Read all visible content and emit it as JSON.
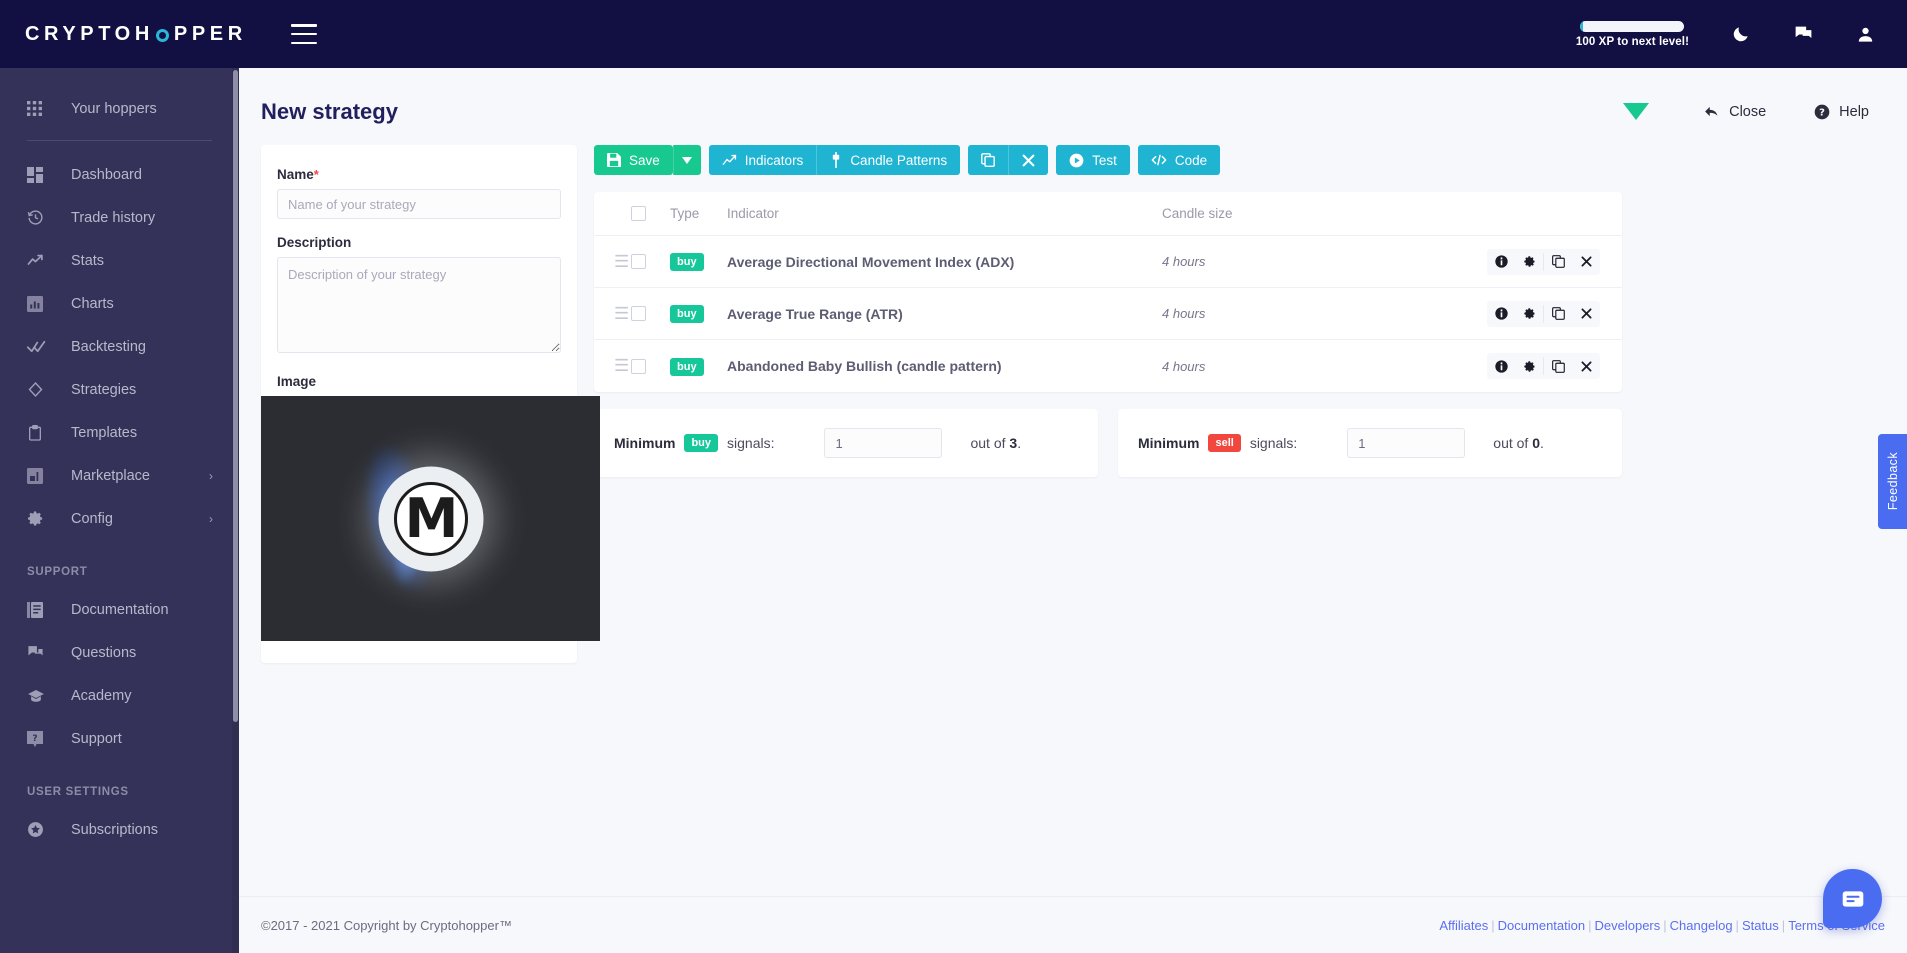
{
  "topbar": {
    "logo_part1": "CRYPTOH",
    "logo_part2": "PPER",
    "menu_icon": "hamburger-icon",
    "xp_text": "100 XP to next level!",
    "xp_percent": 2,
    "dark_mode_icon": "moon-icon",
    "messages_icon": "chat-icon",
    "account_icon": "user-icon"
  },
  "sidebar": {
    "items": [
      {
        "label": "Your hoppers",
        "icon": "grid-icon",
        "chevron": ""
      },
      {
        "label": "Dashboard",
        "icon": "dashboard-icon",
        "chevron": ""
      },
      {
        "label": "Trade history",
        "icon": "history-icon",
        "chevron": ""
      },
      {
        "label": "Stats",
        "icon": "trending-up-icon",
        "chevron": ""
      },
      {
        "label": "Charts",
        "icon": "bar-chart-icon",
        "chevron": ""
      },
      {
        "label": "Backtesting",
        "icon": "double-check-icon",
        "chevron": ""
      },
      {
        "label": "Strategies",
        "icon": "diamond-icon",
        "chevron": ""
      },
      {
        "label": "Templates",
        "icon": "clipboard-icon",
        "chevron": ""
      },
      {
        "label": "Marketplace",
        "icon": "store-icon",
        "chevron": "›"
      },
      {
        "label": "Config",
        "icon": "gear-icon",
        "chevron": "›"
      }
    ],
    "support_title": "SUPPORT",
    "support_items": [
      {
        "label": "Documentation",
        "icon": "book-icon"
      },
      {
        "label": "Questions",
        "icon": "comments-icon"
      },
      {
        "label": "Academy",
        "icon": "graduation-cap-icon"
      },
      {
        "label": "Support",
        "icon": "help-badge-icon"
      }
    ],
    "user_settings_title": "USER SETTINGS",
    "user_settings_items": [
      {
        "label": "Subscriptions",
        "icon": "star-circle-icon"
      }
    ]
  },
  "header": {
    "title": "New strategy",
    "signal_icon": "green-signal-triangle-icon",
    "close_label": "Close",
    "close_icon": "back-arrow-icon",
    "help_label": "Help",
    "help_icon": "question-circle-icon"
  },
  "form": {
    "name_label": "Name",
    "name_required": "*",
    "name_value": "",
    "name_placeholder": "Name of your strategy",
    "description_label": "Description",
    "description_value": "",
    "description_placeholder": "Description of your strategy",
    "image_label": "Image",
    "image_alt": "monero-logo-dark-background"
  },
  "toolbar": {
    "save_label": "Save",
    "save_icon": "floppy-disk-icon",
    "save_caret_icon": "caret-down-icon",
    "indicators_label": "Indicators",
    "indicators_icon": "line-chart-icon",
    "candle_patterns_label": "Candle Patterns",
    "candle_patterns_icon": "candlestick-icon",
    "copy_icon": "copy-icon",
    "delete_icon": "close-x-icon",
    "test_label": "Test",
    "test_icon": "play-circle-icon",
    "code_label": "Code",
    "code_icon": "code-brackets-icon"
  },
  "table": {
    "columns": [
      "Type",
      "Indicator",
      "Candle size"
    ],
    "select_all_checked": false,
    "row_actions": [
      "info-icon",
      "gear-icon",
      "copy-icon",
      "close-x-icon"
    ],
    "rows": [
      {
        "drag_handle": "drag-handle-icon",
        "checked": false,
        "type": "buy",
        "indicator": "Average Directional Movement Index (ADX)",
        "candle_size": "4 hours"
      },
      {
        "drag_handle": "drag-handle-icon",
        "checked": false,
        "type": "buy",
        "indicator": "Average True Range (ATR)",
        "candle_size": "4 hours"
      },
      {
        "drag_handle": "drag-handle-icon",
        "checked": false,
        "type": "buy",
        "indicator": "Abandoned Baby Bullish (candle pattern)",
        "candle_size": "4 hours"
      }
    ]
  },
  "minimum_signals": {
    "buy": {
      "label": "Minimum",
      "badge": "buy",
      "signals_text": "signals:",
      "value": "1",
      "out_of_prefix": "out of ",
      "out_of_count": "3",
      "out_of_suffix": "."
    },
    "sell": {
      "label": "Minimum",
      "badge": "sell",
      "signals_text": "signals:",
      "value": "1",
      "out_of_prefix": "out of ",
      "out_of_count": "0",
      "out_of_suffix": "."
    }
  },
  "footer": {
    "copyright": "©2017 - 2021  Copyright by Cryptohopper™",
    "links": [
      "Affiliates",
      "Documentation",
      "Developers",
      "Changelog",
      "Status",
      "Terms of Service"
    ]
  },
  "floating": {
    "feedback_label": "Feedback",
    "chat_icon": "chat-bubble-icon"
  },
  "colors": {
    "brand_dark": "#120f42",
    "sidebar": "#343258",
    "accent_cyan": "#1eb4d2",
    "accent_green": "#17c98f",
    "badge_buy": "#16c79a",
    "badge_sell": "#f2473f",
    "link_blue": "#5b6ff0",
    "page_bg": "#f7f8fc"
  }
}
